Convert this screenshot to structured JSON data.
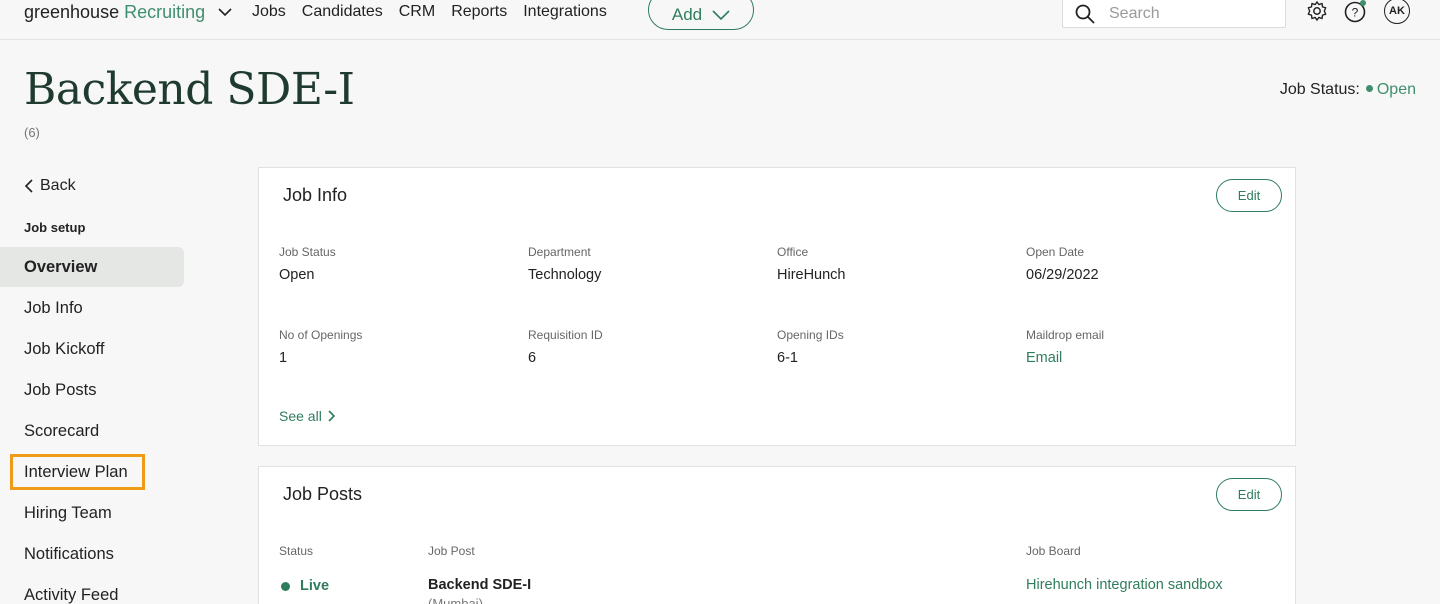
{
  "nav": {
    "brand_main": "greenhouse",
    "brand_sub": "Recruiting",
    "links": [
      "Jobs",
      "Candidates",
      "CRM",
      "Reports",
      "Integrations"
    ],
    "add_label": "Add",
    "search_placeholder": "Search",
    "avatar_initials": "AK"
  },
  "header": {
    "title": "Backend SDE-I",
    "count": "(6)",
    "job_status_label": "Job Status:",
    "job_status_value": "Open"
  },
  "sidebar": {
    "back_label": "Back",
    "heading": "Job setup",
    "items": [
      {
        "label": "Overview"
      },
      {
        "label": "Job Info"
      },
      {
        "label": "Job Kickoff"
      },
      {
        "label": "Job Posts"
      },
      {
        "label": "Scorecard"
      },
      {
        "label": "Interview Plan"
      },
      {
        "label": "Hiring Team"
      },
      {
        "label": "Notifications"
      },
      {
        "label": "Activity Feed"
      }
    ]
  },
  "job_info": {
    "title": "Job Info",
    "edit_label": "Edit",
    "fields": [
      {
        "label": "Job Status",
        "value": "Open"
      },
      {
        "label": "Department",
        "value": "Technology"
      },
      {
        "label": "Office",
        "value": "HireHunch"
      },
      {
        "label": "Open Date",
        "value": "06/29/2022"
      },
      {
        "label": "No of Openings",
        "value": "1"
      },
      {
        "label": "Requisition ID",
        "value": "6"
      },
      {
        "label": "Opening IDs",
        "value": "6-1"
      },
      {
        "label": "Maildrop email",
        "value": "Email"
      }
    ],
    "see_all_label": "See all"
  },
  "job_posts": {
    "title": "Job Posts",
    "edit_label": "Edit",
    "columns": {
      "status": "Status",
      "post": "Job Post",
      "board": "Job Board"
    },
    "rows": [
      {
        "status": "Live",
        "post": "Backend SDE-I",
        "post_sub": "(Mumbai)",
        "board": "Hirehunch integration sandbox"
      }
    ]
  },
  "colors": {
    "accent": "#2f7d5c",
    "highlight": "#f09a1a"
  }
}
